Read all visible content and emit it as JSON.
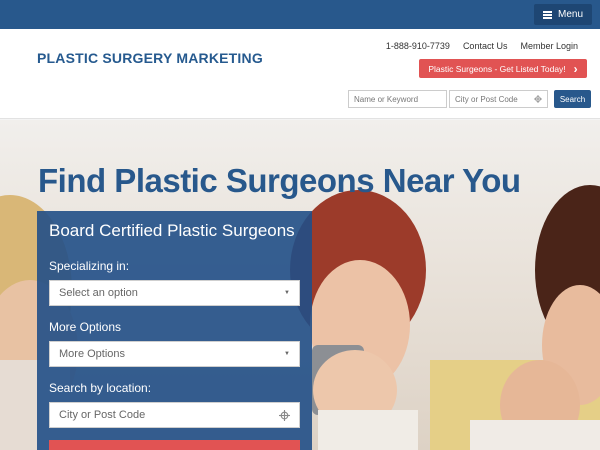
{
  "topbar": {
    "menu_label": "Menu"
  },
  "header": {
    "logo": "PLASTIC SURGERY MARKETING",
    "links": {
      "phone": "1-888-910-7739",
      "contact": "Contact Us",
      "login": "Member Login"
    },
    "cta_label": "Plastic Surgeons - Get Listed Today!",
    "search": {
      "keyword_placeholder": "Name or Keyword",
      "location_placeholder": "City or Post Code",
      "button_label": "Search"
    }
  },
  "hero": {
    "heading": "Find Plastic Surgeons Near You",
    "panel": {
      "title": "Board Certified Plastic Surgeons",
      "specializing_label": "Specializing in:",
      "specializing_value": "Select an option",
      "more_label": "More Options",
      "more_value": "More Options",
      "location_label": "Search by location:",
      "location_placeholder": "City or Post Code"
    }
  },
  "colors": {
    "brand_blue": "#28588c",
    "accent_red": "#e15353"
  },
  "icons": [
    "hamburger-icon",
    "chevron-right-icon",
    "crosshair-icon",
    "caret-down-icon"
  ]
}
